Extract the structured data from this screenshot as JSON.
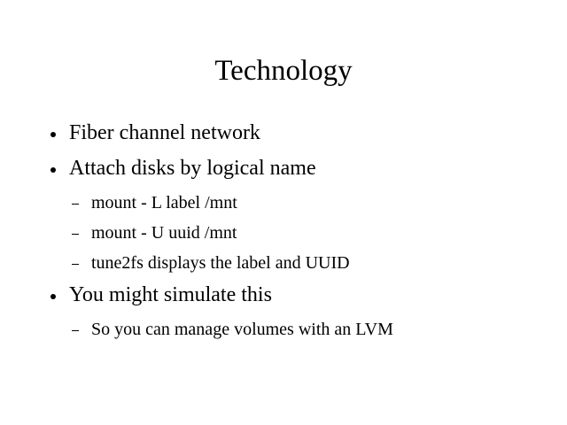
{
  "slide": {
    "title": "Technology",
    "items": [
      {
        "level": 1,
        "text": "Fiber channel network"
      },
      {
        "level": 1,
        "text": "Attach disks by logical name"
      },
      {
        "level": 2,
        "text": "mount - L label /mnt"
      },
      {
        "level": 2,
        "text": "mount - U uuid /mnt"
      },
      {
        "level": 2,
        "text": "tune2fs displays the label and UUID"
      },
      {
        "level": 1,
        "text": "You might simulate this"
      },
      {
        "level": 2,
        "text": "So you can manage volumes with an LVM"
      }
    ]
  }
}
